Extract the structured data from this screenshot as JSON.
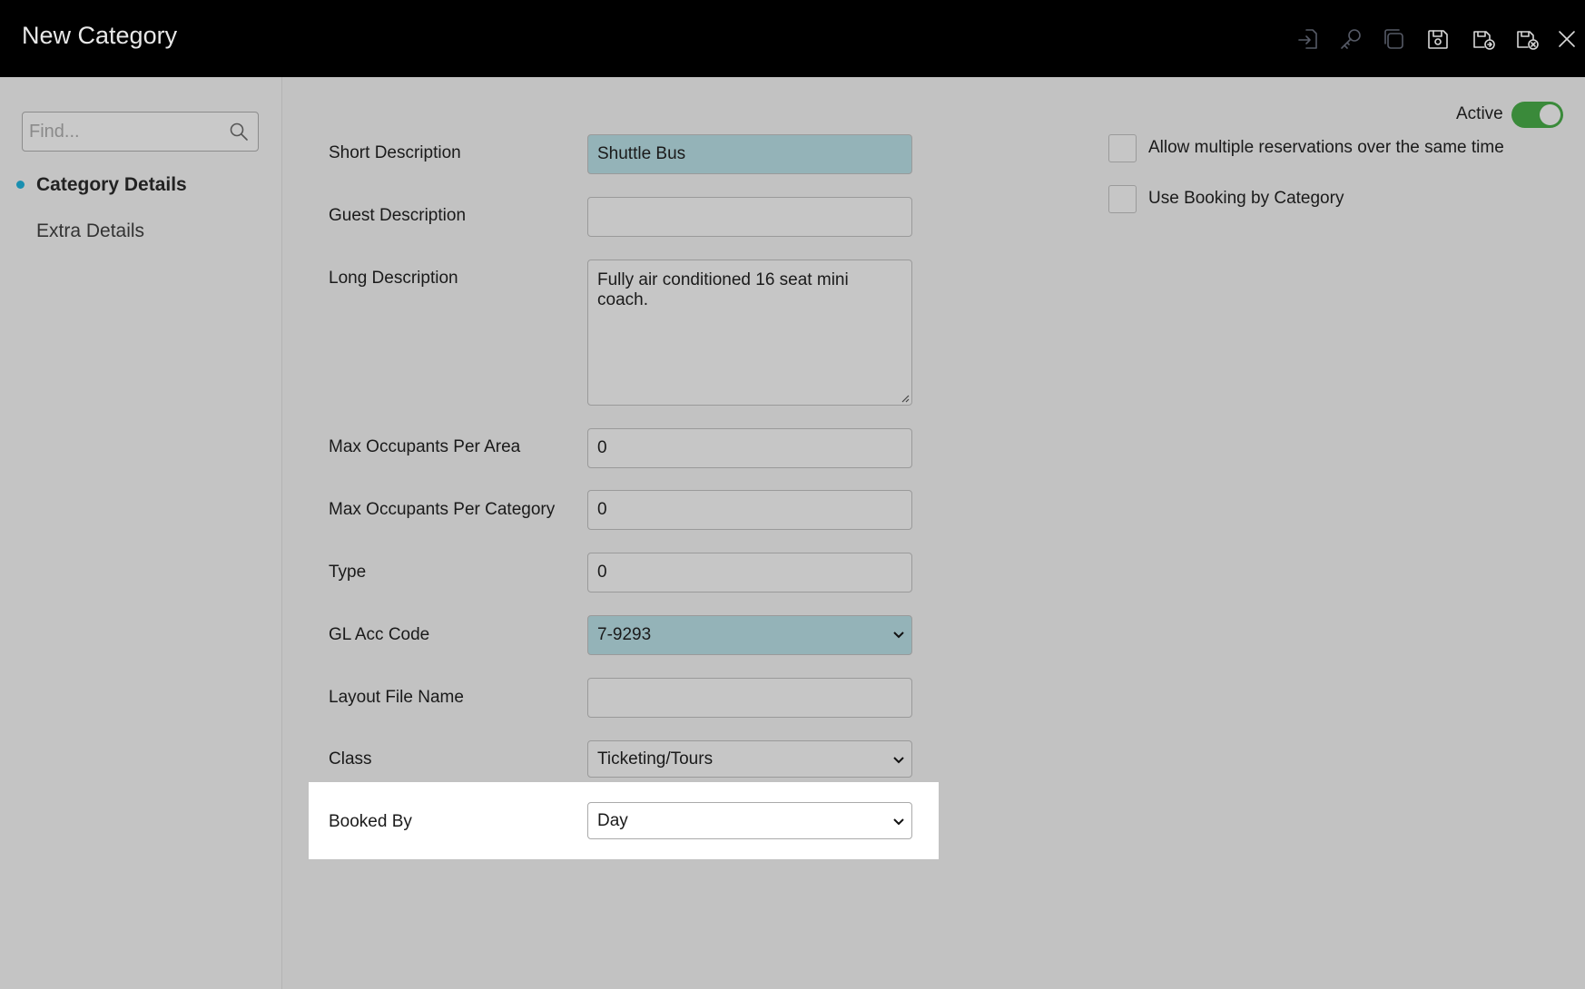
{
  "window": {
    "title": "New Category"
  },
  "toolbar": [
    {
      "name": "import-icon",
      "state": "disabled"
    },
    {
      "name": "key-icon",
      "state": "disabled"
    },
    {
      "name": "copy-icon",
      "state": "disabled"
    },
    {
      "name": "save-icon",
      "state": "enabled"
    },
    {
      "name": "save-and-new-icon",
      "state": "enabled"
    },
    {
      "name": "save-and-close-icon",
      "state": "enabled"
    },
    {
      "name": "close-icon",
      "state": "enabled"
    }
  ],
  "sidebar": {
    "search_placeholder": "Find...",
    "items": [
      {
        "label": "Category Details",
        "active": true
      },
      {
        "label": "Extra Details",
        "active": false
      }
    ]
  },
  "form": {
    "short_description": {
      "label": "Short Description",
      "value": "Shuttle Bus"
    },
    "guest_description": {
      "label": "Guest Description",
      "value": ""
    },
    "long_description": {
      "label": "Long Description",
      "value": "Fully air conditioned 16 seat mini coach."
    },
    "max_occupants_area": {
      "label": "Max Occupants Per Area",
      "value": "0"
    },
    "max_occupants_category": {
      "label": "Max Occupants Per Category",
      "value": "0"
    },
    "type": {
      "label": "Type",
      "value": "0"
    },
    "gl_acc_code": {
      "label": "GL Acc Code",
      "value": "7-9293"
    },
    "layout_file_name": {
      "label": "Layout File Name",
      "value": ""
    },
    "class": {
      "label": "Class",
      "value": "Ticketing/Tours"
    },
    "booked_by": {
      "label": "Booked By",
      "value": "Day"
    }
  },
  "options": {
    "active_label": "Active",
    "active": true,
    "allow_multiple": {
      "label": "Allow multiple reservations over the same time",
      "checked": false
    },
    "booking_by_category": {
      "label": "Use Booking by Category",
      "checked": false
    }
  },
  "colors": {
    "titlebar": "#000000",
    "background": "#c2c2c2",
    "highlighted_field": "#94b3b8",
    "toggle_on": "#3a8a3a",
    "nav_dot": "#1a8fb0"
  }
}
